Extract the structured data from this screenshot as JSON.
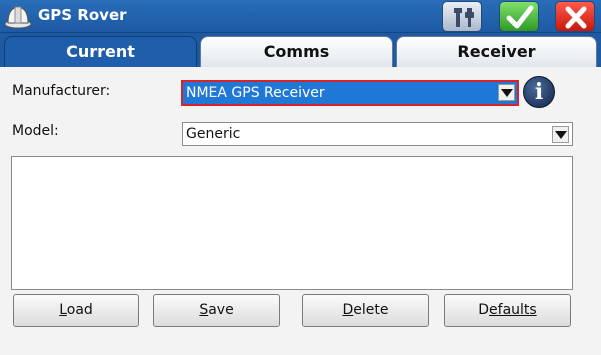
{
  "window": {
    "title": "GPS Rover"
  },
  "title_buttons": {
    "tools_icon": "tools-icon",
    "ok_icon": "checkmark-icon",
    "close_icon": "close-icon"
  },
  "tabs": [
    {
      "label": "Current",
      "active": true
    },
    {
      "label": "Comms",
      "active": false
    },
    {
      "label": "Receiver",
      "active": false
    }
  ],
  "form": {
    "manufacturer_label": "Manufacturer:",
    "manufacturer_value": "NMEA GPS Receiver",
    "model_label": "Model:",
    "model_value": "Generic"
  },
  "buttons": {
    "load": {
      "first": "L",
      "rest": "oad"
    },
    "save": {
      "first": "S",
      "rest": "ave"
    },
    "delete": {
      "first": "D",
      "rest": "elete"
    },
    "defaults": {
      "first": "D",
      "rest": "efaults"
    }
  },
  "colors": {
    "titlebar": "#1d5aa3",
    "selection": "#1f78d6",
    "focus_border": "#d9232b"
  }
}
